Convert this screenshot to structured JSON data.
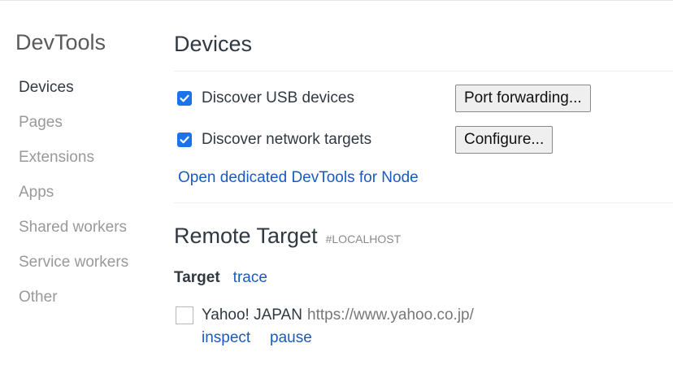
{
  "sidebar": {
    "title": "DevTools",
    "items": [
      {
        "label": "Devices"
      },
      {
        "label": "Pages"
      },
      {
        "label": "Extensions"
      },
      {
        "label": "Apps"
      },
      {
        "label": "Shared workers"
      },
      {
        "label": "Service workers"
      },
      {
        "label": "Other"
      }
    ],
    "selected": "Devices"
  },
  "devices": {
    "title": "Devices",
    "discover_usb": {
      "label": "Discover USB devices",
      "checked": true
    },
    "discover_network": {
      "label": "Discover network targets",
      "checked": true
    },
    "port_forwarding_button": "Port forwarding...",
    "configure_button": "Configure...",
    "node_link": "Open dedicated DevTools for Node"
  },
  "remote_target": {
    "title": "Remote Target",
    "host": "#LOCALHOST",
    "target_label": "Target",
    "trace_link": "trace",
    "targets": [
      {
        "name": "Yahoo! JAPAN",
        "url": "https://www.yahoo.co.jp/",
        "checked": false,
        "actions": [
          "inspect",
          "pause"
        ]
      }
    ]
  },
  "colors": {
    "accent": "#1a73e8",
    "link": "#1a5bbf",
    "muted_text": "#999999",
    "text": "#303942"
  }
}
